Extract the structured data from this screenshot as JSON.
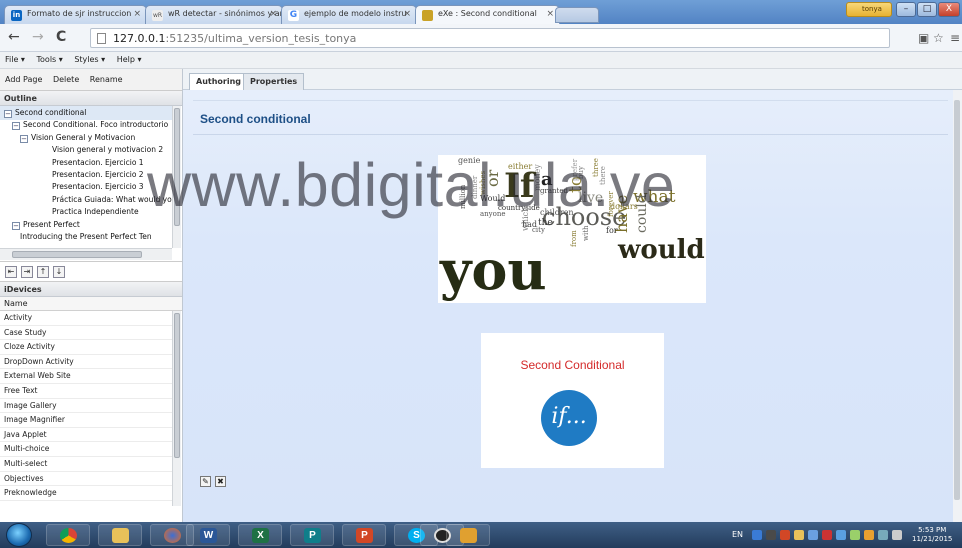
{
  "browser": {
    "tabs": [
      {
        "label": "Formato de sjr instruccion",
        "icon": "linkedin-icon",
        "color": "#0a66c2"
      },
      {
        "label": "wR detectar - sinónimos y an",
        "icon": "wordreference-icon",
        "color": "#6b6b6b"
      },
      {
        "label": "ejemplo de modelo instru",
        "icon": "google-icon",
        "color": "#4285f4"
      },
      {
        "label": "eXe : Second conditional",
        "icon": "exe-icon",
        "color": "#c9a227"
      }
    ],
    "user": "tonya",
    "address": {
      "host": "127.0.0.1",
      "path": ":51235/ultima_version_tesis_tonya"
    },
    "window_buttons": {
      "minimize": "–",
      "maximize": "□",
      "close": "X"
    }
  },
  "menubar": [
    "File ▾",
    "Tools ▾",
    "Styles ▾",
    "Help ▾"
  ],
  "left": {
    "page_actions": [
      "Add Page",
      "Delete",
      "Rename"
    ],
    "outline_title": "Outline",
    "outline": [
      {
        "label": "Second conditional",
        "level": 0,
        "exp": "⊟",
        "selected": true
      },
      {
        "label": "Second Conditional. Foco introductorio",
        "level": 1,
        "exp": "⊟"
      },
      {
        "label": "Vision General y Motivacion",
        "level": 2,
        "exp": "⊟"
      },
      {
        "label": "Vision general y motivacion 2",
        "level": 3
      },
      {
        "label": "Presentacion. Ejercicio 1",
        "level": 3
      },
      {
        "label": "Presentacion. Ejercicio 2",
        "level": 3
      },
      {
        "label": "Presentacion. Ejercicio 3",
        "level": 3
      },
      {
        "label": "Práctica Guiada: What would you",
        "level": 3
      },
      {
        "label": "Practica Independiente",
        "level": 3
      },
      {
        "label": "Present Perfect",
        "level": 1,
        "exp": "⊟"
      },
      {
        "label": "Introducing the Present Perfect Ten",
        "level": 2
      }
    ],
    "idevices_title": "iDevices",
    "idevices_column": "Name",
    "idevices": [
      "Activity",
      "Case Study",
      "Cloze Activity",
      "DropDown Activity",
      "External Web Site",
      "Free Text",
      "Image Gallery",
      "Image Magnifier",
      "Java Applet",
      "Multi-choice",
      "Multi-select",
      "Objectives",
      "Preknowledge"
    ]
  },
  "main": {
    "tabs": [
      "Authoring",
      "Properties"
    ],
    "page_title": "Second conditional",
    "wordcloud": [
      "you",
      "would",
      "If",
      "choose",
      "a",
      "to",
      "what",
      "live",
      "have",
      "could",
      "genie",
      "either",
      "money",
      "prefer",
      "dollars",
      "children",
      "city",
      "countryside",
      "granted",
      "wishes",
      "anyone",
      "Would",
      "which",
      "the",
      "had",
      "from",
      "with",
      "for",
      "forever",
      "or",
      "three",
      "million",
      "dinner",
      "buy",
      "there"
    ],
    "card_title": "Second Conditional",
    "card_logo": "if..."
  },
  "watermark": "www.bdigital.ula.ve",
  "taskbar": {
    "lang": "EN",
    "time": "5:53 PM",
    "date": "11/21/2015"
  }
}
